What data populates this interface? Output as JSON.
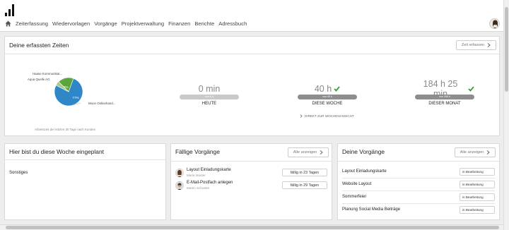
{
  "nav": {
    "items": [
      "Zeiterfassung",
      "Wiedervorlagen",
      "Vorgänge",
      "Projektverwaltung",
      "Finanzen",
      "Berichte",
      "Adressbuch"
    ]
  },
  "times": {
    "title": "Deine erfassten Zeiten",
    "button": "Zeit erfassen",
    "pie_caption": "Arbeitszeit der letzten 30 Tage nach Kunden",
    "chart_data": {
      "type": "pie",
      "slices": [
        {
          "label": "Moon Onlinehand...",
          "value": 77,
          "display": "77%",
          "color": "#2f87c8"
        },
        {
          "label": "Aqua Quelle AG",
          "value": 18,
          "display": "18%",
          "color": "#5aa43a"
        },
        {
          "label": "Haase Kommunikat...",
          "value": 5,
          "display": "",
          "color": "#a7c98b"
        }
      ]
    },
    "stats": [
      {
        "value": "0 min",
        "bar": "von 8 h",
        "label": "HEUTE",
        "check": false,
        "fill": 0,
        "bar_color": "#c9c9c9"
      },
      {
        "value": "40 h",
        "bar": "von 40 h",
        "label": "DIESE WOCHE",
        "check": true,
        "fill": 1,
        "bar_color": "#8d8d8d"
      },
      {
        "value": "184 h 25 min",
        "bar": "von 168 h",
        "label": "DIESER MONAT",
        "check": true,
        "fill": 1,
        "bar_color": "#8d8d8d"
      }
    ],
    "week_link": "DIREKT ZUR WOCHENANSICHT"
  },
  "plan": {
    "title": "Hier bist du diese Woche eingeplant",
    "items": [
      "Sonstiges"
    ]
  },
  "due": {
    "title": "Fällige Vorgänge",
    "button": "Alle anzeigen",
    "items": [
      {
        "title": "Layout Einladungskarte",
        "person": "Maria Muster",
        "due": "fällig in 23 Tagen"
      },
      {
        "title": "E-Mail-Postfach anlegen",
        "person": "Martin Schuster",
        "due": "fällig in 29 Tagen"
      }
    ]
  },
  "mine": {
    "title": "Deine Vorgänge",
    "button": "Alle anzeigen",
    "items": [
      {
        "title": "Layout Einladungskarte",
        "status": "in Bearbeitung"
      },
      {
        "title": "Website Layout",
        "status": "in Bearbeitung"
      },
      {
        "title": "Sommerfeier",
        "status": "in Bearbeitung"
      },
      {
        "title": "Planung Social Media Beiträge",
        "status": "in Bearbeitung"
      }
    ]
  },
  "colors": {
    "check": "#3a9a3a",
    "accent": "#2f87c8"
  }
}
